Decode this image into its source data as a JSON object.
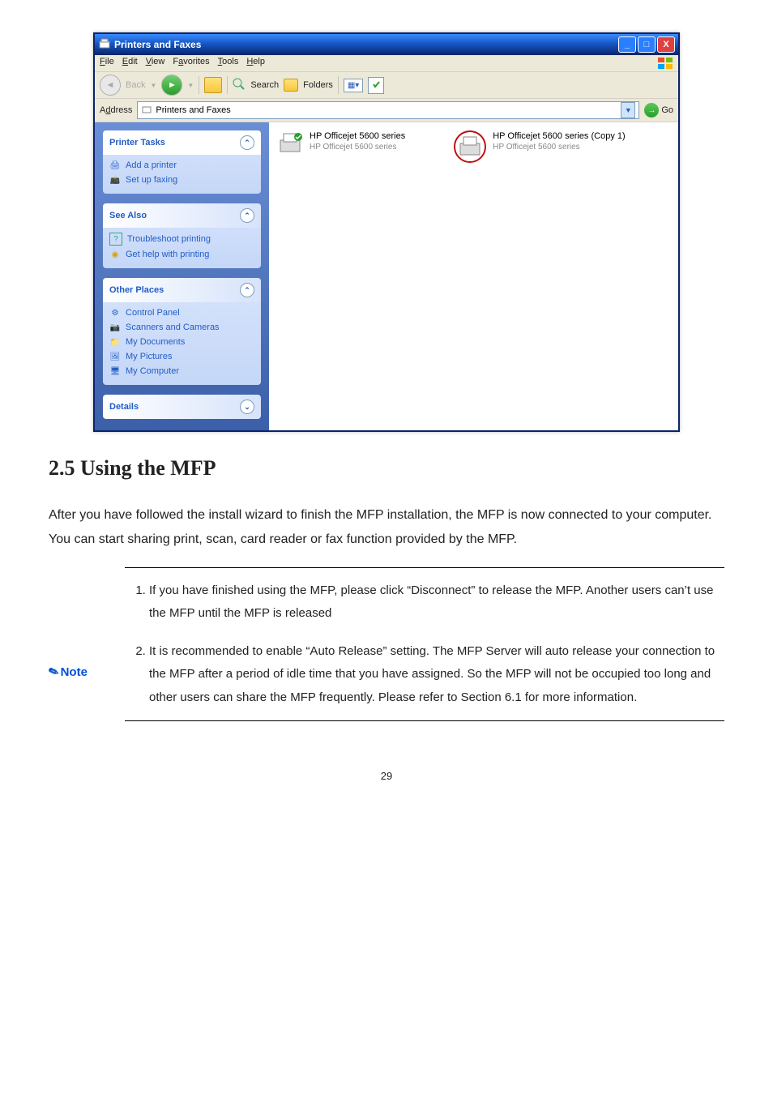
{
  "window": {
    "title": "Printers and Faxes",
    "menu": {
      "file": "File",
      "edit": "Edit",
      "view": "View",
      "favorites": "Favorites",
      "tools": "Tools",
      "help": "Help"
    },
    "toolbar": {
      "back": "Back",
      "search": "Search",
      "folders": "Folders"
    },
    "addressbar": {
      "label": "Address",
      "value": "Printers and Faxes",
      "go": "Go"
    },
    "sidepane": {
      "printerTasks": {
        "title": "Printer Tasks",
        "addPrinter": "Add a printer",
        "setupFaxing": "Set up faxing"
      },
      "seeAlso": {
        "title": "See Also",
        "troubleshoot": "Troubleshoot printing",
        "getHelp": "Get help with printing"
      },
      "otherPlaces": {
        "title": "Other Places",
        "controlPanel": "Control Panel",
        "scanners": "Scanners and Cameras",
        "myDocs": "My Documents",
        "myPics": "My Pictures",
        "myComp": "My Computer"
      },
      "details": {
        "title": "Details"
      }
    },
    "printers": {
      "p1": {
        "name": "HP Officejet 5600 series",
        "sub": "HP Officejet 5600 series"
      },
      "p2": {
        "name": "HP Officejet 5600 series (Copy 1)",
        "sub": "HP Officejet 5600 series"
      }
    }
  },
  "doc": {
    "heading": "2.5 Using the MFP",
    "paragraph": "After you have followed the install wizard to finish the MFP installation, the MFP is now connected to your computer. You can start sharing print, scan, card reader or fax function provided by the MFP.",
    "noteLabel": "Note",
    "note1": "If you have finished using the MFP, please click “Disconnect” to release the MFP. Another users can’t use the MFP until the MFP is released",
    "note2": " It is recommended to enable “Auto Release” setting. The MFP Server will auto release your connection to the MFP after a period of idle time that you have assigned. So the MFP will not be occupied too long and other users can share the MFP frequently. Please refer to Section 6.1 for more information.",
    "pagenum": "29"
  }
}
